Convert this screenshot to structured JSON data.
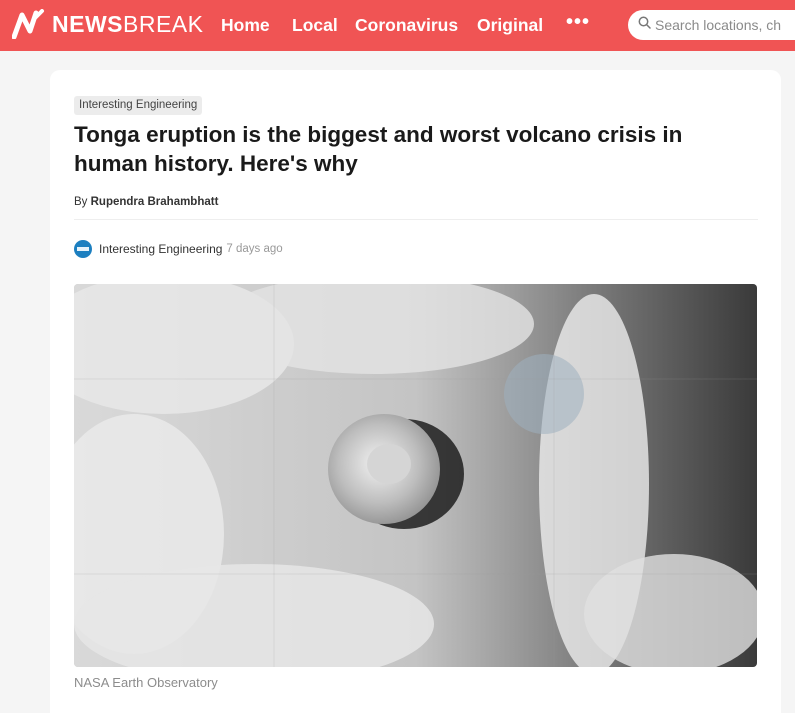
{
  "header": {
    "logo_bold": "NEWS",
    "logo_regular": "BREAK",
    "nav": [
      "Home",
      "Local",
      "Coronavirus",
      "Original"
    ],
    "more_label": "•••",
    "search_placeholder": "Search locations, ch",
    "accent_color": "#f05454",
    "icons": [
      "newsbreak-logo-icon",
      "more-icon",
      "search-icon"
    ]
  },
  "article": {
    "category_tag": "Interesting Engineering",
    "title": "Tonga eruption is the biggest and worst volcano crisis in human history. Here's why",
    "byline_prefix": "By",
    "author": "Rupendra Brahambhatt",
    "source_name": "Interesting Engineering",
    "time_ago": "7 days ago",
    "image_caption": "NASA Earth Observatory"
  }
}
